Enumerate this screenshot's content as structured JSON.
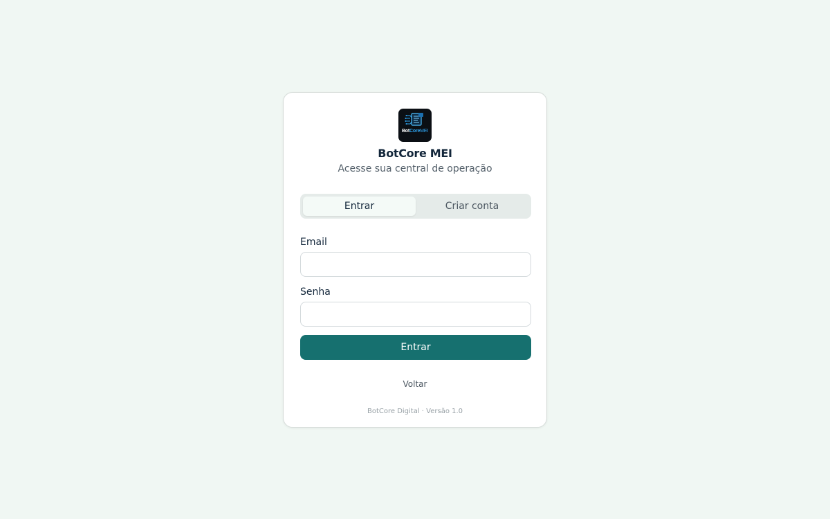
{
  "brand": {
    "logo_text_bot": "Bot",
    "logo_text_core": "Core",
    "logo_text_mei": "MEI",
    "title": "BotCore MEI",
    "subtitle": "Acesse sua central de operação"
  },
  "tabs": [
    {
      "label": "Entrar",
      "active": true
    },
    {
      "label": "Criar conta",
      "active": false
    }
  ],
  "form": {
    "email_label": "Email",
    "email_value": "",
    "password_label": "Senha",
    "password_value": "",
    "submit_label": "Entrar"
  },
  "back_label": "Voltar",
  "footer": "BotCore Digital · Versão 1.0",
  "colors": {
    "page_background": "#f0f7f3",
    "primary": "#16706f",
    "logo_accent": "#2ea4f0"
  }
}
